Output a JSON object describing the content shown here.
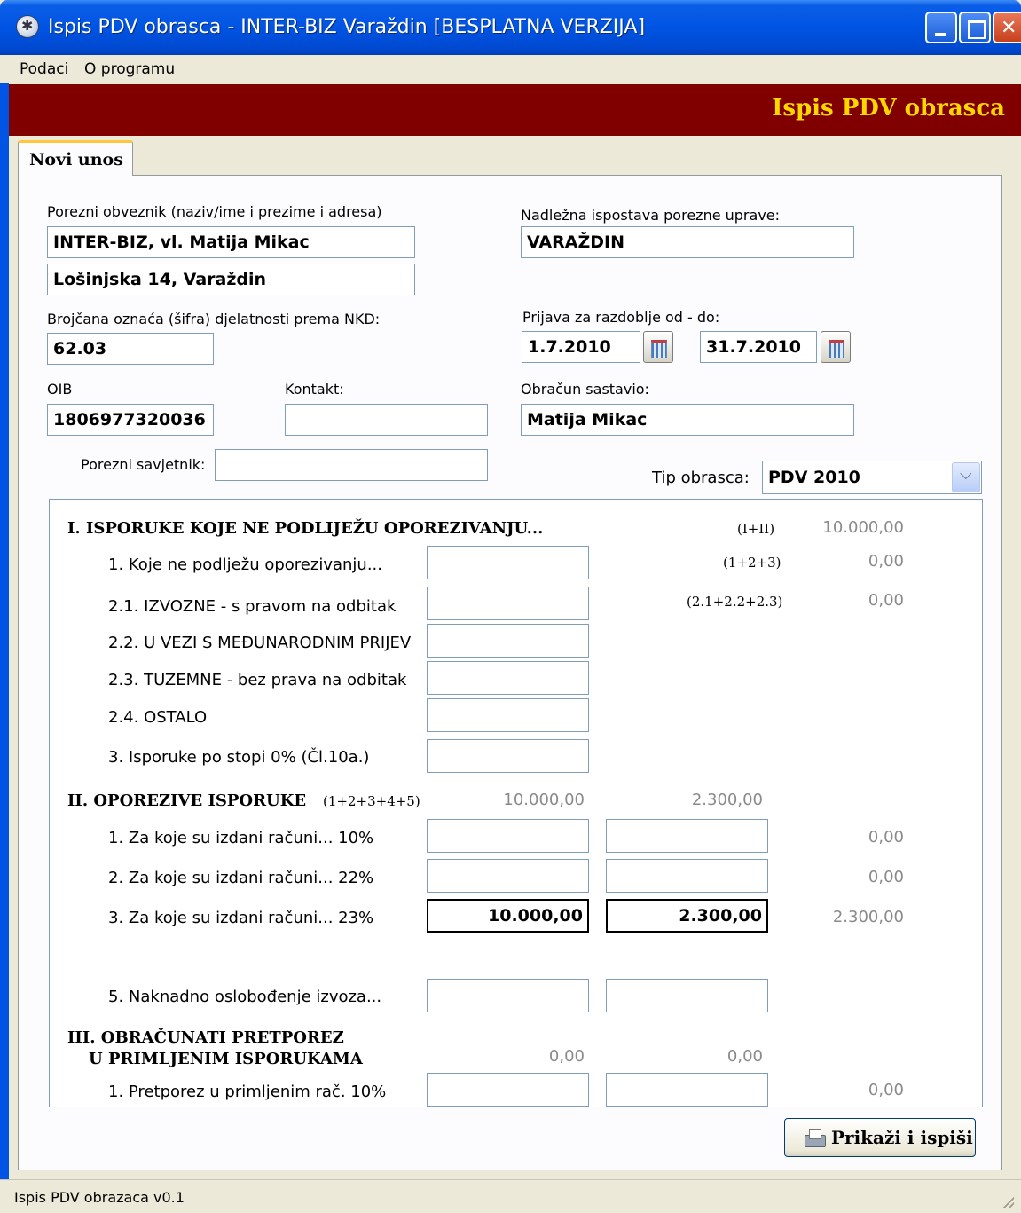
{
  "window": {
    "title": "Ispis PDV obrasca - INTER-BIZ Varaždin [BESPLATNA VERZIJA]"
  },
  "menu": {
    "items": [
      {
        "label": "Podaci"
      },
      {
        "label": "O programu"
      }
    ]
  },
  "banner": {
    "title": "Ispis PDV obrasca"
  },
  "tab": {
    "label": "Novi unos"
  },
  "form": {
    "obveznik_label": "Porezni obveznik (naziv/ime i prezime i adresa)",
    "obveznik_name": "INTER-BIZ, vl. Matija Mikac",
    "obveznik_address": "Lošinjska 14, Varaždin",
    "ispostava_label": "Nadležna ispostava porezne uprave:",
    "ispostava_value": "VARAŽDIN",
    "nkd_label": "Brojčana oznaća (šifra) djelatnosti prema NKD:",
    "nkd_value": "62.03",
    "razdoblje_label": "Prijava za razdoblje od - do:",
    "date_from": "1.7.2010",
    "date_to": "31.7.2010",
    "oib_label": "OIB",
    "oib_value": "1806977320036",
    "kontakt_label": "Kontakt:",
    "kontakt_value": "",
    "sastavio_label": "Obračun sastavio:",
    "sastavio_value": "Matija Mikac",
    "savjetnik_label": "Porezni savjetnik:",
    "savjetnik_value": "",
    "tip_label": "Tip obrasca:",
    "tip_value": "PDV 2010"
  },
  "sections": {
    "s1": {
      "title": "I. ISPORUKE KOJE NE PODLIJEŽU OPOREZIVANJU...",
      "formula": "(I+II)",
      "total": "10.000,00",
      "rows": [
        {
          "label": "1. Koje ne podlježu oporezivanju...",
          "formula": "(1+2+3)",
          "value": "0,00"
        },
        {
          "label": "2.1. IZVOZNE - s pravom na odbitak",
          "formula": "(2.1+2.2+2.3)",
          "value": "0,00"
        },
        {
          "label": "2.2. U VEZI S MEĐUNARODNIM PRIJEV"
        },
        {
          "label": "2.3. TUZEMNE - bez prava na odbitak"
        },
        {
          "label": "2.4. OSTALO"
        },
        {
          "label": "3. Isporuke po stopi 0% (Čl.10a.)"
        }
      ]
    },
    "s2": {
      "title": "II. OPOREZIVE ISPORUKE",
      "formula": "(1+2+3+4+5)",
      "base_total": "10.000,00",
      "tax_total": "2.300,00",
      "rows": [
        {
          "label": "1. Za koje su izdani računi... 10%",
          "base": "",
          "tax": "",
          "value": "0,00"
        },
        {
          "label": "2. Za koje su izdani računi... 22%",
          "base": "",
          "tax": "",
          "value": "0,00"
        },
        {
          "label": "3. Za koje su izdani računi... 23%",
          "base": "10.000,00",
          "tax": "2.300,00",
          "value": "2.300,00"
        },
        {
          "label": "5. Naknadno oslobođenje izvoza...",
          "base": "",
          "tax": ""
        }
      ]
    },
    "s3": {
      "title_line1": "III. OBRAČUNATI PRETPOREZ",
      "title_line2": "U PRIMLJENIM ISPORUKAMA",
      "base_total": "0,00",
      "tax_total": "0,00",
      "rows": [
        {
          "label": "1. Pretporez u primljenim rač. 10%",
          "value": "0,00"
        }
      ]
    }
  },
  "buttons": {
    "print_label": "Prikaži i ispiši"
  },
  "status": {
    "text": "Ispis PDV obrazaca v0.1"
  }
}
